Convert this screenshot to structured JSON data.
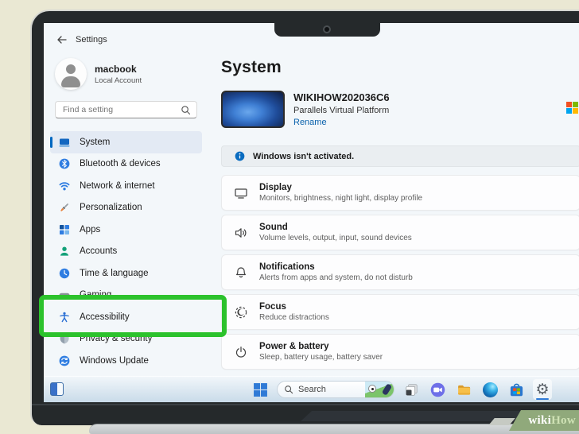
{
  "colors": {
    "accent": "#0067c0",
    "highlight_green": "#2cc22c"
  },
  "window": {
    "title": "Settings"
  },
  "account": {
    "name": "macbook",
    "type": "Local Account"
  },
  "search": {
    "placeholder": "Find a setting"
  },
  "sidebar": {
    "items": [
      {
        "label": "System"
      },
      {
        "label": "Bluetooth & devices"
      },
      {
        "label": "Network & internet"
      },
      {
        "label": "Personalization"
      },
      {
        "label": "Apps"
      },
      {
        "label": "Accounts"
      },
      {
        "label": "Time & language"
      },
      {
        "label": "Gaming"
      },
      {
        "label": "Accessibility"
      },
      {
        "label": "Privacy & security"
      },
      {
        "label": "Windows Update"
      }
    ]
  },
  "main": {
    "title": "System",
    "device": {
      "name": "WIKIHOW202036C6",
      "platform": "Parallels Virtual Platform",
      "rename_label": "Rename"
    },
    "banner": {
      "text": "Windows isn't activated."
    },
    "rows": [
      {
        "title": "Display",
        "subtitle": "Monitors, brightness, night light, display profile"
      },
      {
        "title": "Sound",
        "subtitle": "Volume levels, output, input, sound devices"
      },
      {
        "title": "Notifications",
        "subtitle": "Alerts from apps and system, do not disturb"
      },
      {
        "title": "Focus",
        "subtitle": "Reduce distractions"
      },
      {
        "title": "Power & battery",
        "subtitle": "Sleep, battery usage, battery saver"
      }
    ]
  },
  "taskbar": {
    "search_label": "Search"
  },
  "watermark": {
    "wiki": "wiki",
    "how": "How"
  }
}
